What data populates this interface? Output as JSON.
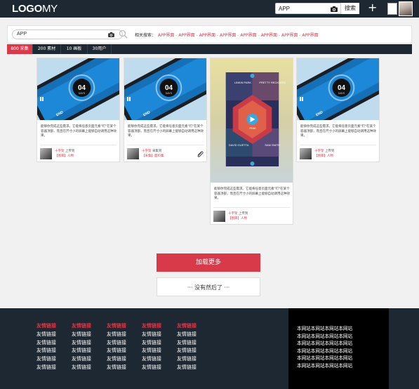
{
  "header": {
    "logo_bold": "LOGO",
    "logo_light": "MY",
    "search_value": "APP",
    "search_button": "搜索",
    "plus_label": "+"
  },
  "search_panel": {
    "input_value": "APP",
    "related_label": "相关搜索：",
    "related_items": [
      "APP界面",
      "APP界面",
      "APP界面",
      "APP界面",
      "APP界面",
      "APP界面",
      "APP界面",
      "APP界面"
    ],
    "separator": " - "
  },
  "tabs": [
    {
      "label": "800 采集",
      "active": true
    },
    {
      "label": "200 素材",
      "active": false
    },
    {
      "label": "10 画板",
      "active": false
    },
    {
      "label": "30用户",
      "active": false
    }
  ],
  "cards": [
    {
      "desc": "能够你完成这些需求。它能将任意页面元素\"钉\"在某个容器顶部，而且在尺寸小的屏幕上能够自动调用这种效果。",
      "author": "十字架",
      "action": "上传到",
      "category": "【图库】人物",
      "clip": false
    },
    {
      "desc": "能够你完成这些需求。它能将任意页面元素\"钉\"在某个容器顶部，而且在尺寸小的屏幕上能够自动调用这种效果。",
      "author": "十字架",
      "action": "采集到",
      "category": "【采集】面料集",
      "clip": true
    },
    {
      "desc": "能够你完成这些需求。它能将任意页面元素\"钉\"在某个容器顶部，而且在尺寸小的屏幕上能够自动调用这种效果。",
      "author": "十字架",
      "action": "上传到",
      "category": "【图库】人物",
      "clip": false
    },
    {
      "desc": "能够你完成这些需求。它能将任意页面元素\"钉\"在某个容器顶部，而且在尺寸小的屏幕上能够自动调用这种效果。",
      "author": "十字架",
      "action": "上传到",
      "category": "【图库】人物",
      "clip": false
    }
  ],
  "phone_screen": {
    "value": "04",
    "unit": "DAYS",
    "bottom": "END"
  },
  "poster": {
    "left_top": "LINKIN PARK",
    "right_top": "PRETTY RECKLESS",
    "center": "PINK",
    "left_bottom": "DAVID GUETTA",
    "right_bottom": "SAM SMITH"
  },
  "load_more": "加载更多",
  "no_more": "··· 没有然后了 ···",
  "footer": {
    "columns": [
      {
        "heading": "友情链接",
        "links": [
          "友情链接",
          "友情链接",
          "友情链接",
          "友情链接",
          "友情链接"
        ]
      },
      {
        "heading": "友情链接",
        "links": [
          "友情链接",
          "友情链接",
          "友情链接",
          "友情链接",
          "友情链接"
        ]
      },
      {
        "heading": "友情链接",
        "links": [
          "友情链接",
          "友情链接",
          "友情链接",
          "友情链接",
          "友情链接"
        ]
      },
      {
        "heading": "友情链接",
        "links": [
          "友情链接",
          "友情链接",
          "友情链接",
          "友情链接",
          "友情链接"
        ]
      },
      {
        "heading": "友情链接",
        "links": [
          "友情链接",
          "友情链接",
          "友情链接",
          "友情链接",
          "友情链接"
        ]
      }
    ],
    "site_lines": [
      "本网站本网站本网站本网站",
      "本网站本网站本网站本网站",
      "本网站本网站本网站本网站",
      "本网站本网站本网站本网站",
      "本网站本网站本网站本网站",
      "本网站本网站本网站本网站"
    ]
  },
  "colors": {
    "accent": "#d93a4a",
    "dark": "#1e2833",
    "phone_blue": "#1e88d8"
  }
}
